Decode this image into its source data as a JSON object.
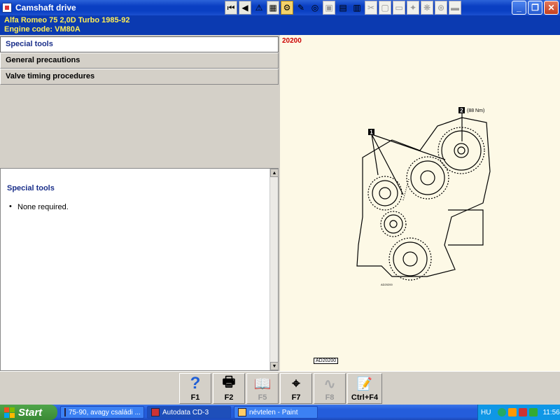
{
  "window": {
    "title": "Camshaft drive",
    "min_glyph": "_",
    "max_glyph": "❐",
    "close_glyph": "✕"
  },
  "vehicle": {
    "line1": "Alfa Romeo   75  2,0D Turbo 1985-92",
    "line2": "Engine code: VM80A"
  },
  "menu": {
    "items": [
      {
        "label": "Special tools",
        "selected": true
      },
      {
        "label": "General precautions",
        "selected": false
      },
      {
        "label": "Valve timing procedures",
        "selected": false
      }
    ]
  },
  "content": {
    "heading": "Special tools",
    "bullets": [
      "None required."
    ]
  },
  "figure": {
    "code": "20200",
    "ref": "AD20200",
    "callout1": "1",
    "callout2": "2",
    "torque": "(88 Nm)",
    "inner_ref": "AD20200"
  },
  "fkeys": [
    {
      "label": "F1",
      "icon": "help-icon",
      "enabled": true
    },
    {
      "label": "F2",
      "icon": "print-icon",
      "enabled": true
    },
    {
      "label": "F5",
      "icon": "book-icon",
      "enabled": false
    },
    {
      "label": "F7",
      "icon": "compass-icon",
      "enabled": true
    },
    {
      "label": "F8",
      "icon": "wave-icon",
      "enabled": false
    },
    {
      "label": "Ctrl+F4",
      "icon": "notes-icon",
      "enabled": true
    }
  ],
  "taskbar": {
    "start_label": "Start",
    "tasks": [
      {
        "label": "75-90, avagy családi ...",
        "active": false
      },
      {
        "label": "Autodata CD-3",
        "active": true
      },
      {
        "label": "névtelen - Paint",
        "active": false
      }
    ],
    "lang": "HU",
    "clock": "11:56"
  },
  "colors": {
    "vehicle_bg": "#0b3ab1",
    "vehicle_text": "#ffee55",
    "figure_bg": "#fdf9e6",
    "figure_code": "#cc0000",
    "heading": "#1a2f8a"
  }
}
